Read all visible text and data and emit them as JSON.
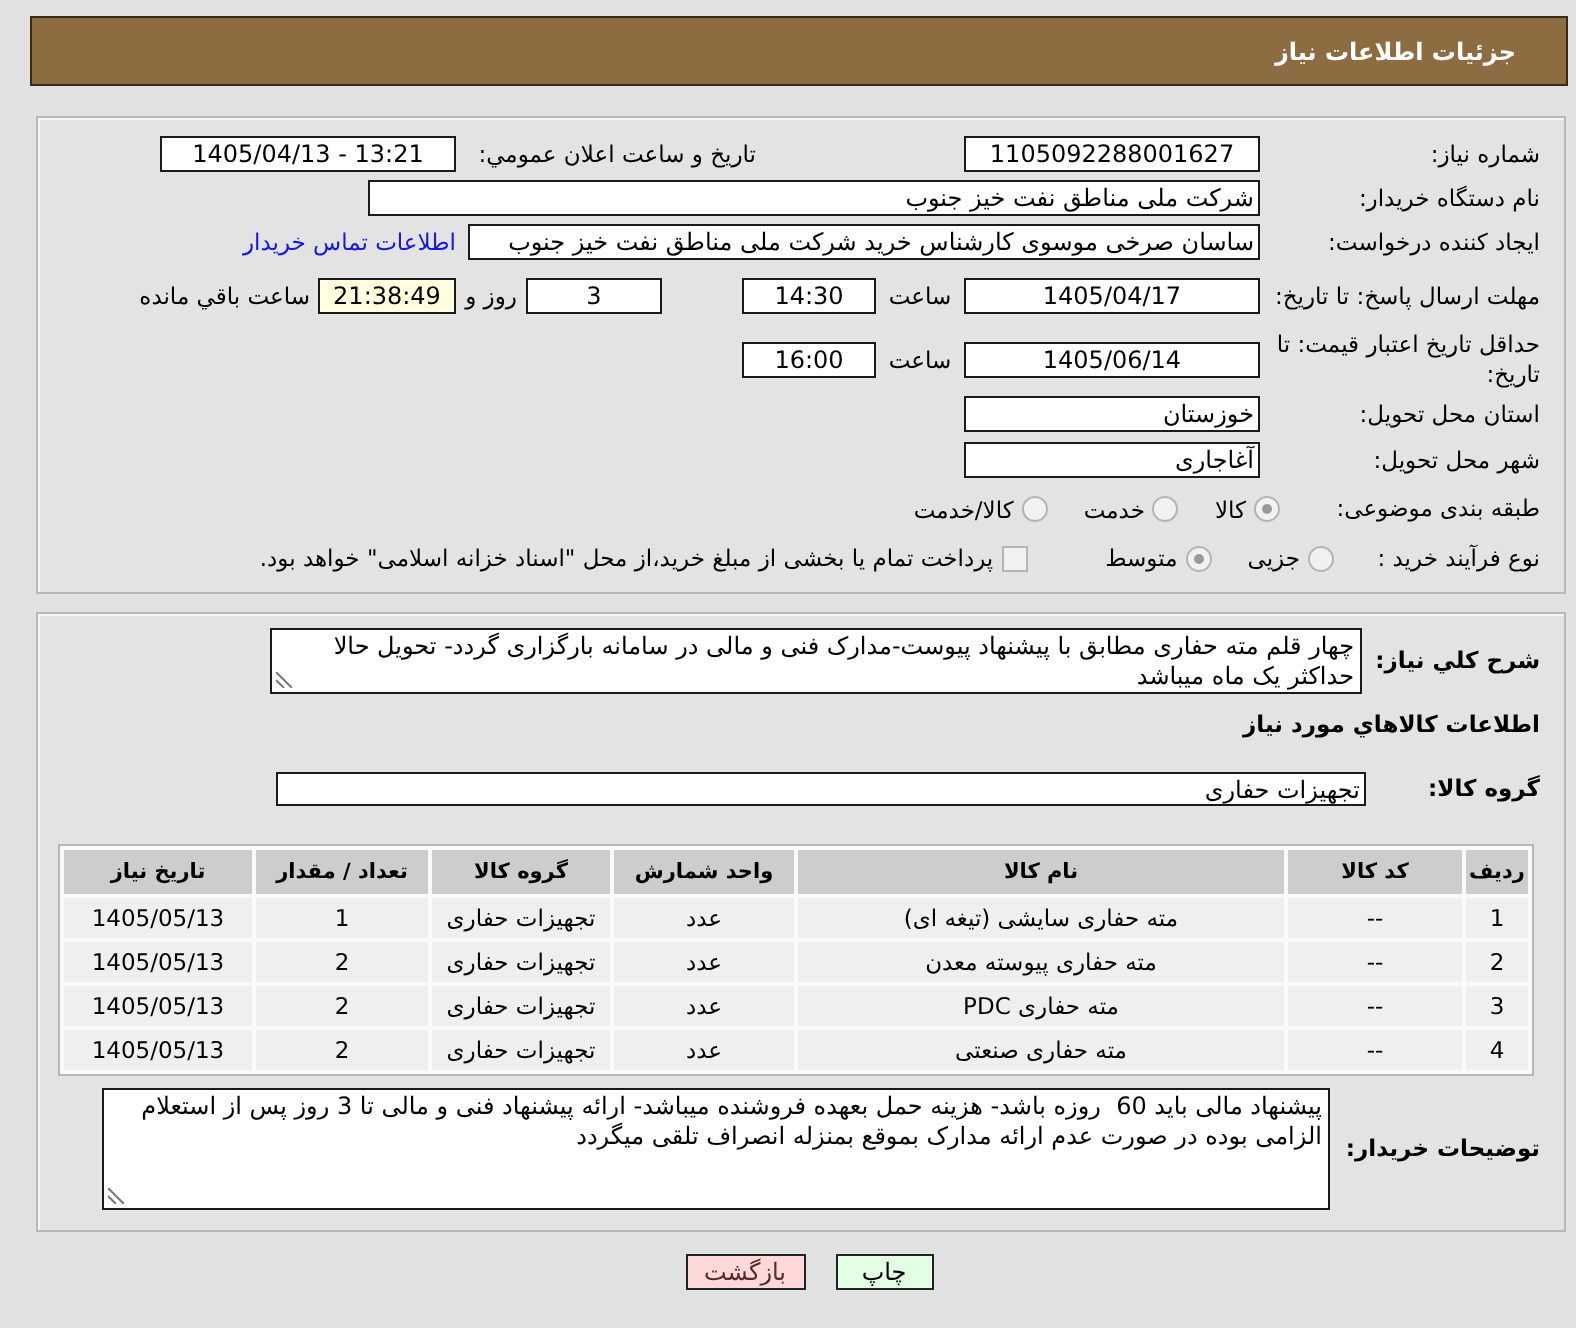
{
  "header": {
    "title": "جزئیات اطلاعات نیاز"
  },
  "details": {
    "need_number": {
      "label": "شماره نیاز:",
      "value": "1105092288001627"
    },
    "announce_datetime": {
      "label": "تاریخ و ساعت اعلان عمومي:",
      "value": "1405/04/13 - 13:21"
    },
    "buyer_org": {
      "label": "نام دستگاه خریدار:",
      "value": "شرکت ملی مناطق نفت خیز جنوب"
    },
    "requester": {
      "label": "ایجاد کننده درخواست:",
      "value": "ساسان صرخی موسوی کارشناس خرید  شرکت ملی مناطق نفت خیز جنوب",
      "contact_link": "اطلاعات تماس خریدار"
    },
    "response_deadline": {
      "label": "مهلت ارسال پاسخ: تا تاریخ:",
      "date": "1405/04/17",
      "time_label": "ساعت",
      "time": "14:30",
      "days": "3",
      "days_label": "روز و",
      "remaining": "21:38:49",
      "remaining_label": "ساعت باقي مانده"
    },
    "price_validity": {
      "label": "حداقل تاریخ اعتبار قیمت: تا تاریخ:",
      "date": "1405/06/14",
      "time_label": "ساعت",
      "time": "16:00"
    },
    "delivery_province": {
      "label": "استان محل تحویل:",
      "value": "خوزستان"
    },
    "delivery_city": {
      "label": "شهر محل تحویل:",
      "value": "آغاجاری"
    },
    "subject_category": {
      "label": "طبقه بندی موضوعی:",
      "options": [
        {
          "label": "کالا",
          "selected": true
        },
        {
          "label": "خدمت",
          "selected": false
        },
        {
          "label": "کالا/خدمت",
          "selected": false
        }
      ]
    },
    "purchase_process": {
      "label": "نوع فرآیند خرید :",
      "options": [
        {
          "label": "جزیی",
          "selected": false
        },
        {
          "label": "متوسط",
          "selected": true
        }
      ],
      "treasury_payment": {
        "label": "پرداخت تمام یا بخشی از مبلغ خرید،از محل \"اسناد خزانه اسلامی\" خواهد بود.",
        "checked": false
      }
    }
  },
  "needs": {
    "description": {
      "label": "شرح کلي نیاز:",
      "value": "چهار قلم مته حفاری مطابق با پیشنهاد پیوست-مدارک فنی و مالی در سامانه بارگزاری گردد- تحویل حالا حداکثر یک ماه میباشد"
    },
    "goods_title": "اطلاعات کالاهاي مورد نیاز",
    "goods_group": {
      "label": "گروه کالا:",
      "value": "تجهیزات حفاری"
    },
    "table": {
      "columns": [
        "ردیف",
        "کد کالا",
        "نام کالا",
        "واحد شمارش",
        "گروه کالا",
        "تعداد / مقدار",
        "تاریخ نیاز"
      ],
      "rows": [
        [
          "1",
          "--",
          "مته حفاری سایشی (تیغه ای)",
          "عدد",
          "تجهیزات حفاری",
          "1",
          "1405/05/13"
        ],
        [
          "2",
          "--",
          "مته حفاری پیوسته معدن",
          "عدد",
          "تجهیزات حفاری",
          "2",
          "1405/05/13"
        ],
        [
          "3",
          "--",
          "مته حفاری PDC",
          "عدد",
          "تجهیزات حفاری",
          "2",
          "1405/05/13"
        ],
        [
          "4",
          "--",
          "مته حفاری صنعتی",
          "عدد",
          "تجهیزات حفاری",
          "2",
          "1405/05/13"
        ]
      ]
    },
    "buyer_notes": {
      "label": "توضیحات خریدار:",
      "value": "پیشنهاد مالی باید 60  روزه باشد- هزینه حمل بعهده فروشنده میباشد- ارائه پیشنهاد فنی و مالی تا 3 روز پس از استعلام الزامی بوده در صورت عدم ارائه مدارک بموقع بمنزله انصراف تلقی میگردد"
    }
  },
  "buttons": [
    {
      "label": "چاپ",
      "kind": "print"
    },
    {
      "label": "بازگشت",
      "kind": "back"
    }
  ]
}
